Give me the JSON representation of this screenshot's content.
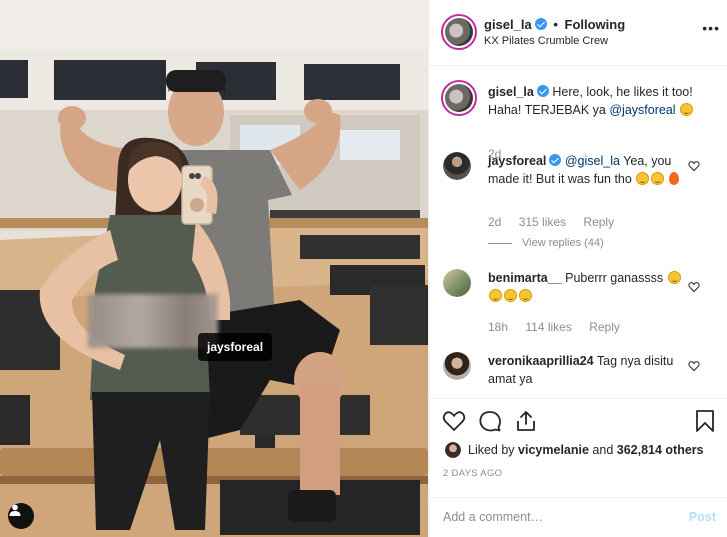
{
  "photo": {
    "tag_label": "jaysforeal"
  },
  "header": {
    "username": "gisel_la",
    "separator": "•",
    "follow_status": "Following",
    "location": "KX Pilates Crumble Crew",
    "more": "•••"
  },
  "caption": {
    "username": "gisel_la",
    "text_before": "Here, look, he likes it too! Haha! TERJEBAK ya ",
    "mention": "@jaysforeal",
    "time": "2d"
  },
  "comments": [
    {
      "username": "jaysforeal",
      "mention": "@gisel_la",
      "text": " Yea, you made it! But it was fun tho ",
      "time": "2d",
      "likes": "315 likes",
      "reply": "Reply",
      "view_replies": "View replies (44)"
    },
    {
      "username": "benimarta__",
      "text": " Puberrr ganassss ",
      "time": "18h",
      "likes": "114 likes",
      "reply": "Reply"
    },
    {
      "username": "veronikaaprillia24",
      "text": " Tag nya disitu amat ya"
    }
  ],
  "actions": {
    "liked_by_prefix": "Liked by ",
    "liked_by_user": "vicymelanie",
    "liked_by_and": " and ",
    "liked_by_count": "362,814 others",
    "timestamp": "2 DAYS AGO"
  },
  "add_comment": {
    "placeholder": "Add a comment…",
    "post_label": "Post"
  },
  "colors": {
    "verified": "#3897f0",
    "link": "#003569",
    "muted": "#8e8e8e",
    "post_disabled": "#b2dffc",
    "story_ring": "#c32aa3"
  }
}
